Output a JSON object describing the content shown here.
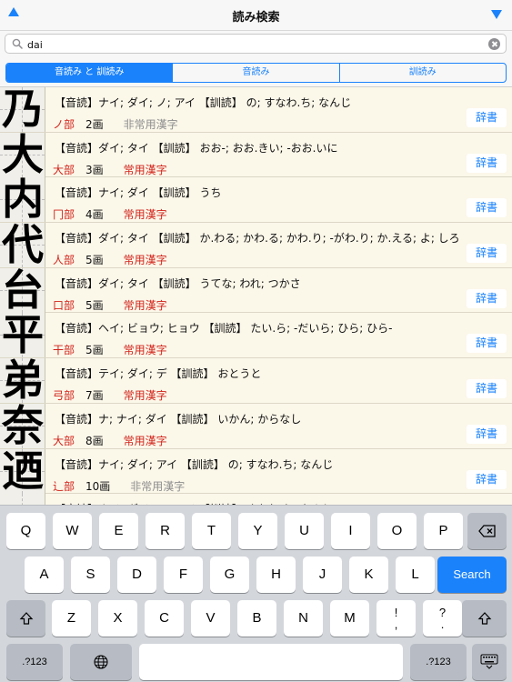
{
  "header": {
    "title": "読み検索",
    "up_icon": "triangle-up-icon",
    "down_icon": "triangle-down-icon",
    "accent": "#1a82fb"
  },
  "search": {
    "value": "dai",
    "placeholder": ""
  },
  "segments": [
    {
      "label": "音読み と 訓読み",
      "selected": true
    },
    {
      "label": "音読み",
      "selected": false
    },
    {
      "label": "訓読み",
      "selected": false
    }
  ],
  "rows": [
    {
      "kanji": "乃",
      "readings": "【音読】ナイ; ダイ; ノ; アイ 【訓読】 の; すなわ.ち; なんじ",
      "radical": "ノ部",
      "strokes": "2画",
      "jouyou": "非常用漢字",
      "jouyou_color": "gray",
      "dict": "辞書"
    },
    {
      "kanji": "大",
      "readings": "【音読】ダイ; タイ 【訓読】 おお-; おお.きい; -おお.いに",
      "radical": "大部",
      "strokes": "3画",
      "jouyou": "常用漢字",
      "jouyou_color": "red",
      "dict": "辞書"
    },
    {
      "kanji": "内",
      "readings": "【音読】ナイ; ダイ 【訓読】 うち",
      "radical": "冂部",
      "strokes": "4画",
      "jouyou": "常用漢字",
      "jouyou_color": "red",
      "dict": "辞書"
    },
    {
      "kanji": "代",
      "readings": "【音読】ダイ; タイ 【訓読】 か.わる; かわ.る; かわ.り; -がわ.り; か.える; よ; しろ",
      "radical": "人部",
      "strokes": "5画",
      "jouyou": "常用漢字",
      "jouyou_color": "red",
      "dict": "辞書"
    },
    {
      "kanji": "台",
      "readings": "【音読】ダイ; タイ 【訓読】 うてな; われ; つかさ",
      "radical": "口部",
      "strokes": "5画",
      "jouyou": "常用漢字",
      "jouyou_color": "red",
      "dict": "辞書"
    },
    {
      "kanji": "平",
      "readings": "【音読】ヘイ; ビョウ; ヒョウ 【訓読】 たい.ら; -だいら; ひら; ひら-",
      "radical": "干部",
      "strokes": "5画",
      "jouyou": "常用漢字",
      "jouyou_color": "red",
      "dict": "辞書"
    },
    {
      "kanji": "弟",
      "readings": "【音読】テイ; ダイ; デ 【訓読】 おとうと",
      "radical": "弓部",
      "strokes": "7画",
      "jouyou": "常用漢字",
      "jouyou_color": "red",
      "dict": "辞書"
    },
    {
      "kanji": "奈",
      "readings": "【音読】ナ; ナイ; ダイ 【訓読】 いかん; からなし",
      "radical": "大部",
      "strokes": "8画",
      "jouyou": "常用漢字",
      "jouyou_color": "red",
      "dict": "辞書"
    },
    {
      "kanji": "迺",
      "readings": "【音読】ナイ; ダイ; アイ 【訓読】 の; すなわ.ち; なんじ",
      "radical": "辶部",
      "strokes": "10画",
      "jouyou": "非常用漢字",
      "jouyou_color": "gray",
      "dict": "辞書"
    },
    {
      "kanji": "",
      "readings": "【音読】ナイ; ダイ; ノ; アイ 【訓読】 すなわ.ち; なんじ",
      "radical": "",
      "strokes": "",
      "jouyou": "",
      "jouyou_color": "gray",
      "dict": ""
    }
  ],
  "keyboard": {
    "row1": [
      "Q",
      "W",
      "E",
      "R",
      "T",
      "Y",
      "U",
      "I",
      "O",
      "P"
    ],
    "row2": [
      "A",
      "S",
      "D",
      "F",
      "G",
      "H",
      "J",
      "K",
      "L"
    ],
    "row3": [
      "Z",
      "X",
      "C",
      "V",
      "B",
      "N",
      "M",
      "!\n,",
      "?\n."
    ],
    "search_label": "Search",
    "numbers_label": ".?123",
    "backspace_icon": "backspace-icon",
    "shift_icon": "shift-icon",
    "globe_icon": "globe-icon",
    "dismiss_icon": "keyboard-dismiss-icon"
  }
}
